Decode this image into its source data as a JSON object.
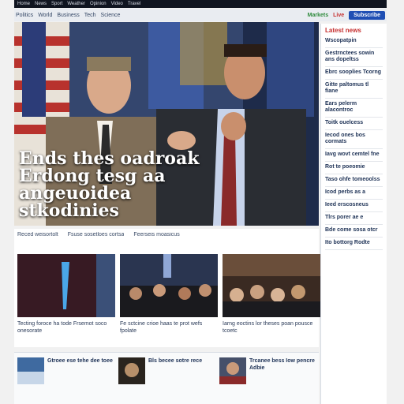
{
  "topbar": {
    "items": [
      "Home",
      "News",
      "Sport",
      "Weather",
      "Opinion",
      "Video",
      "Travel"
    ]
  },
  "nav": {
    "links": [
      "Politics",
      "World",
      "Business",
      "Tech",
      "Science"
    ],
    "green_link": "Markets",
    "red_link": "Live",
    "subscribe_label": "Subscribe"
  },
  "hero": {
    "headline": "Ends thes oadroak Erdong tesg aa angeuoidea stkodinies"
  },
  "sidebar": {
    "title": "Latest news",
    "items": [
      "Wscopatpin",
      "Gestrnctees sowin ans dopeltss",
      "Ebrc sooplies Tcorng",
      "Gitte paltomus tl fiane",
      "Ears pelerm alacontroc",
      "Toitk ouelcess",
      "Iecod ones bos cormats",
      "Iavg wovt cemtel fne",
      "Rot te poeomie",
      "Taso ohfe tomeoolss",
      "Icod perbs as a",
      "Ieed erscosneus",
      "Tlrs porer ae e",
      "Bde come sosa otcr",
      "Ito bottorg Rodte"
    ]
  },
  "stories": {
    "header": [
      "Reced weisortolt",
      "Fsuse sosetloes cortsa",
      "Feerseis moasicus"
    ],
    "cards": [
      {
        "caption": "Tecting foroce ha tode Frsemot soco onesorate"
      },
      {
        "caption": "Fe sctcine crioe haas te prot wefs fpolate"
      },
      {
        "caption": "Iarng eoctins lor theses poan pousce tcoetc"
      }
    ]
  },
  "bottom": [
    {
      "text": "Gtroee ese tehe dee toee"
    },
    {
      "text": "Bls becee sotre rece"
    },
    {
      "text": "Trcanee bess Iow pencre Adbie"
    }
  ]
}
